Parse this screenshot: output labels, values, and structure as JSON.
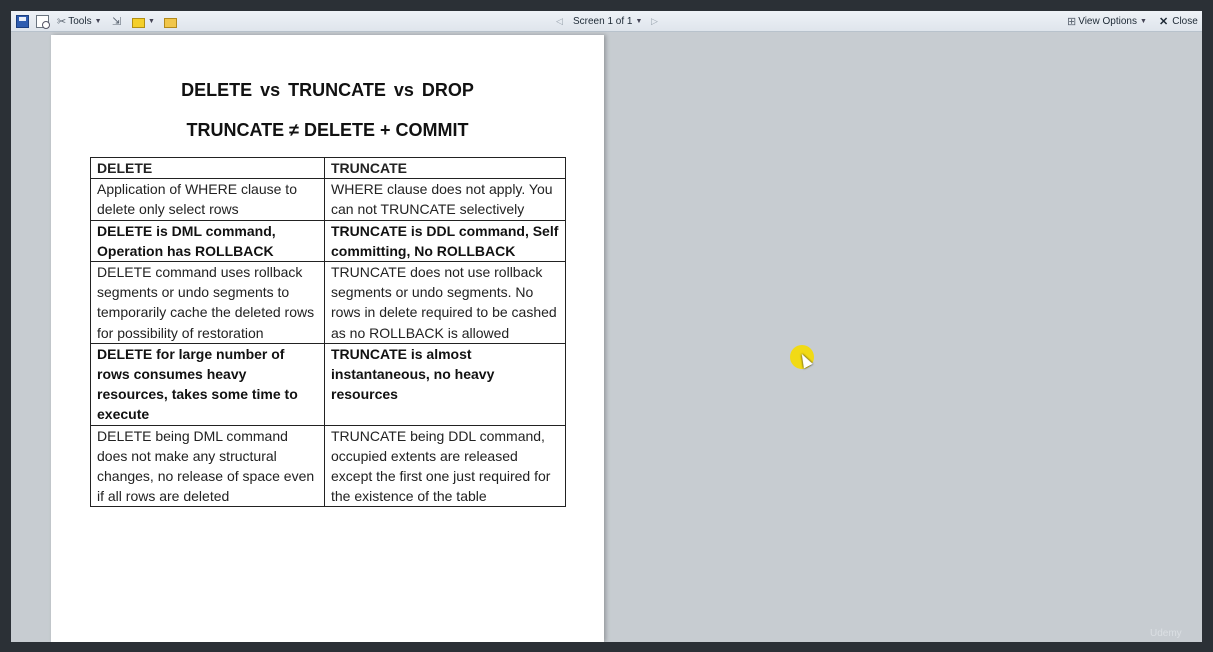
{
  "toolbar": {
    "tools_label": "Tools",
    "screen_indicator": "Screen 1 of 1",
    "view_options_label": "View Options",
    "close_label": "Close"
  },
  "document": {
    "title": "DELETE vs TRUNCATE vs DROP",
    "subtitle": "TRUNCATE ≠ DELETE + COMMIT",
    "table": {
      "headers": [
        "DELETE",
        "TRUNCATE"
      ],
      "rows": [
        {
          "delete": "Application of WHERE clause to delete only select rows",
          "truncate": "WHERE clause does not apply. You can not TRUNCATE selectively",
          "bold": false
        },
        {
          "delete": "DELETE is DML command, Operation has ROLLBACK",
          "truncate": "TRUNCATE is DDL command, Self committing, No ROLLBACK",
          "bold": true
        },
        {
          "delete": "DELETE command uses rollback segments or undo segments to temporarily cache the deleted rows for possibility of restoration",
          "truncate": "TRUNCATE does not use rollback segments or undo segments. No rows in delete required to be cashed as no ROLLBACK is allowed",
          "bold": false
        },
        {
          "delete": "DELETE for large number of rows consumes heavy resources, takes some time to execute",
          "truncate": "TRUNCATE is almost instantaneous, no heavy resources",
          "bold": true
        },
        {
          "delete": "DELETE being DML command does not make any structural changes, no release of space even if all rows are deleted",
          "truncate": "TRUNCATE being DDL command, occupied extents are released except the first one just required for the existence of the table",
          "bold": false
        }
      ]
    }
  },
  "watermark": "Udemy",
  "colors": {
    "cursor_highlight": "#f5dc00",
    "viewer_background": "#c7ccd1"
  }
}
